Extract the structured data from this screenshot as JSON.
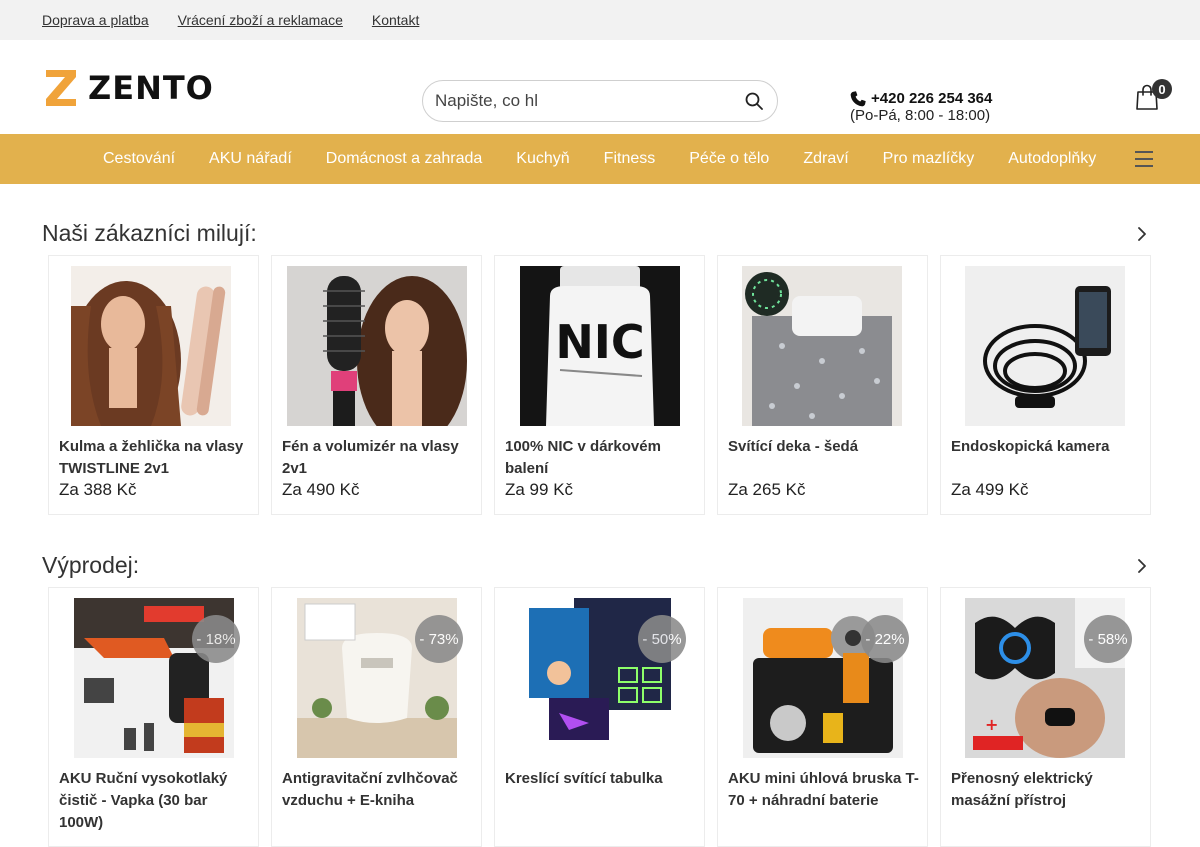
{
  "topbar": {
    "links": [
      "Doprava a platba",
      "Vrácení zboží a reklamace",
      "Kontakt"
    ]
  },
  "header": {
    "logo_text": "ZENTO",
    "logo_color": "#f0a33a",
    "search": {
      "placeholder": "Napište, co hl"
    },
    "phone": "+420 226 254 364",
    "hours": "(Po-Pá, 8:00 - 18:00)",
    "cart_count": "0"
  },
  "nav": {
    "background": "#e2b14d",
    "items": [
      "Cestování",
      "AKU nářadí",
      "Domácnost a zahrada",
      "Kuchyň",
      "Fitness",
      "Péče o tělo",
      "Zdraví",
      "Pro mazlíčky",
      "Autodoplňky"
    ],
    "menu_icon": "hamburger-icon"
  },
  "favorites": {
    "title": "Naši zákazníci milují:",
    "products": [
      {
        "name": "Kulma a žehlička na vlasy TWISTLINE 2v1",
        "price": "Za 388 Kč",
        "image": "hair-straightener"
      },
      {
        "name": "Fén a volumizér na vlasy 2v1",
        "price": "Za 490 Kč",
        "image": "hair-dryer-brush"
      },
      {
        "name": "100% NIC v dárkovém balení",
        "price": "Za 99 Kč",
        "image": "nic-jar",
        "image_text": "NIC"
      },
      {
        "name": "Svítící deka - šedá",
        "price": "Za 265 Kč",
        "image": "glowing-blanket"
      },
      {
        "name": "Endoskopická kamera",
        "price": "Za 499 Kč",
        "image": "endoscope-camera"
      }
    ]
  },
  "sale": {
    "title": "Výprodej:",
    "products": [
      {
        "name": "AKU Ruční vysokotlaký čistič - Vapka (30 bar 100W)",
        "discount": "- 18%",
        "image": "pressure-washer"
      },
      {
        "name": "Antigravitační zvlhčovač vzduchu + E-kniha",
        "discount": "- 73%",
        "image": "humidifier"
      },
      {
        "name": "Kreslící svítící tabulka",
        "discount": "- 50%",
        "image": "drawing-board"
      },
      {
        "name": "AKU mini úhlová bruska T-70 + náhradní baterie",
        "discount": "- 22%",
        "image": "angle-grinder"
      },
      {
        "name": "Přenosný elektrický masážní přístroj",
        "discount": "- 58%",
        "image": "massager"
      }
    ]
  }
}
